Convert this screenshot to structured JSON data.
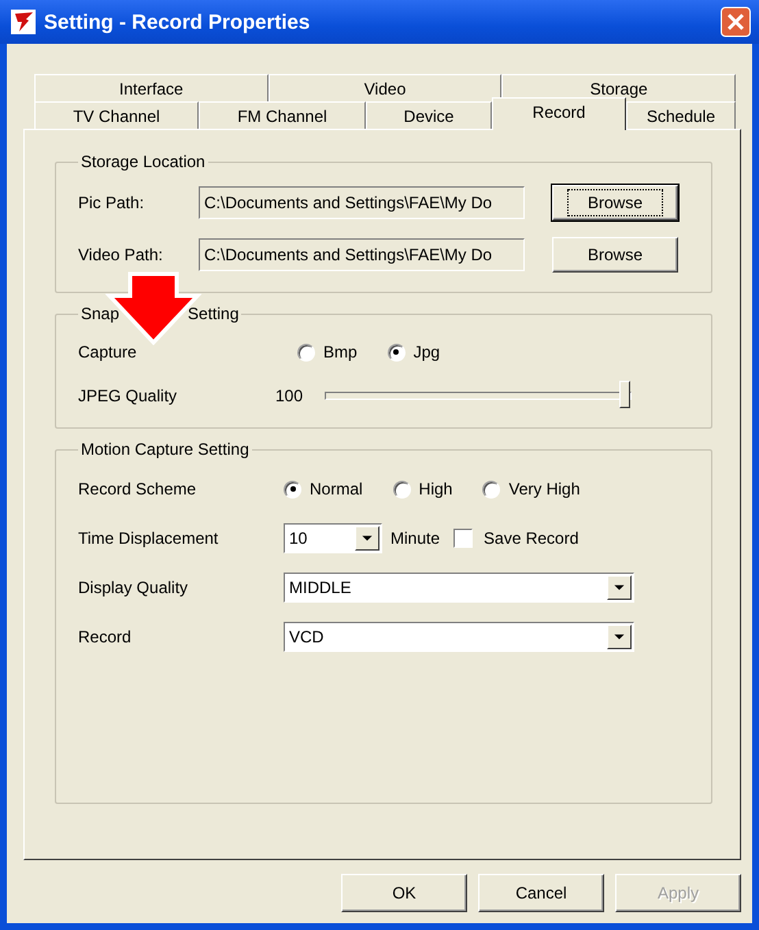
{
  "window": {
    "title": "Setting - Record Properties"
  },
  "tab_rows": [
    [
      {
        "label": "Interface",
        "selected": false
      },
      {
        "label": "Video",
        "selected": false
      },
      {
        "label": "Storage",
        "selected": false
      }
    ],
    [
      {
        "label": "TV Channel",
        "selected": false
      },
      {
        "label": "FM Channel",
        "selected": false
      },
      {
        "label": "Device",
        "selected": false
      },
      {
        "label": "Record",
        "selected": true
      },
      {
        "label": "Schedule",
        "selected": false
      }
    ]
  ],
  "storage_location": {
    "title": "Storage Location",
    "rows": [
      {
        "label": "Pic Path:",
        "value": "C:\\Documents and Settings\\FAE\\My Do",
        "button": "Browse",
        "focused": true
      },
      {
        "label": "Video Path:",
        "value": "C:\\Documents and Settings\\FAE\\My Do",
        "button": "Browse",
        "focused": false
      }
    ]
  },
  "snapshot_setting": {
    "title_parts": [
      "Snap",
      "Setting"
    ],
    "capture": {
      "label": "Capture",
      "options": [
        {
          "label": "Bmp",
          "selected": false
        },
        {
          "label": "Jpg",
          "selected": true
        }
      ]
    },
    "jpeg_quality": {
      "label": "JPEG Quality",
      "reading": "100",
      "level": 1.0
    }
  },
  "motion_capture_setting": {
    "title": "Motion Capture Setting",
    "record_scheme": {
      "label": "Record Scheme",
      "options": [
        {
          "label": "Normal",
          "selected": true
        },
        {
          "label": "High",
          "selected": false
        },
        {
          "label": "Very High",
          "selected": false
        }
      ]
    },
    "time_displacement": {
      "label": "Time Displacement",
      "value": "10",
      "unit": "Minute"
    },
    "save_record": {
      "label": "Save Record",
      "checked": false
    },
    "display_quality": {
      "label": "Display Quality",
      "value": "MIDDLE"
    },
    "record": {
      "label": "Record",
      "value": "VCD"
    }
  },
  "buttons": [
    {
      "label": "OK",
      "disabled": false
    },
    {
      "label": "Cancel",
      "disabled": false
    },
    {
      "label": "Apply",
      "disabled": true
    }
  ]
}
